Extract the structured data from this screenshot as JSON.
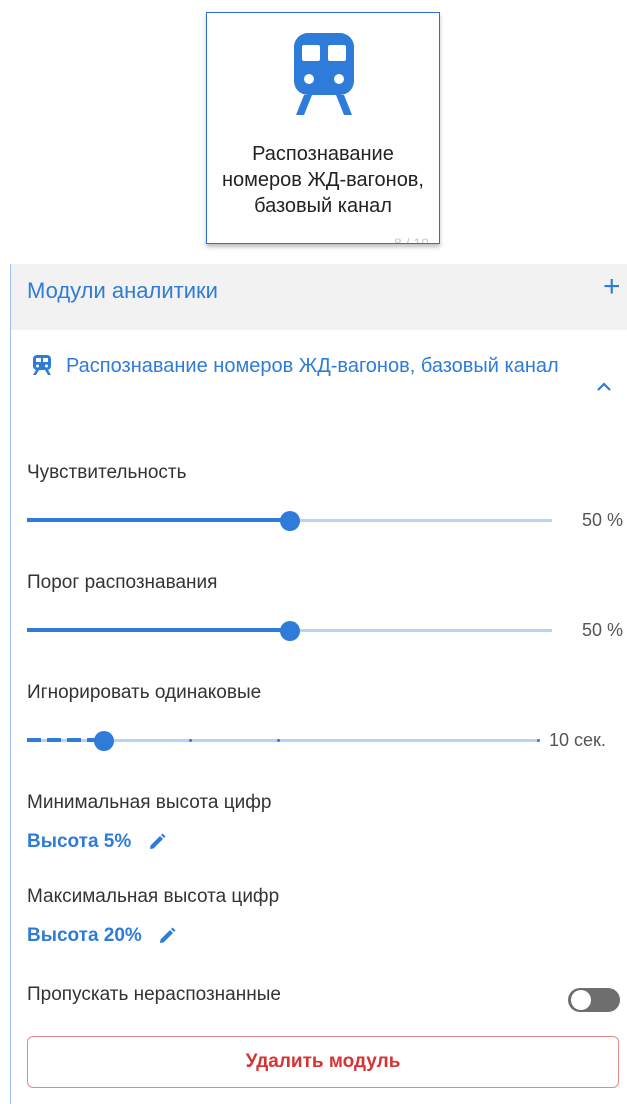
{
  "tile": {
    "icon": "train-icon",
    "label": "Распознавание номеров ЖД-вагонов, базовый канал",
    "counter": "8 / 10"
  },
  "panel": {
    "title": "Модули аналитики",
    "add_icon": "plus-icon",
    "add_label": "+"
  },
  "module": {
    "icon": "train-icon",
    "title": "Распознавание номеров ЖД-вагонов, базовый канал",
    "expanded_icon": "chevron-up-icon"
  },
  "sensitivity": {
    "label": "Чувствительность",
    "value": 50,
    "display": "50 %"
  },
  "threshold": {
    "label": "Порог распознавания",
    "value": 50,
    "display": "50 %"
  },
  "ignore_same": {
    "label": "Игнорировать одинаковые",
    "value_fraction": 0.15,
    "display": "10 сек."
  },
  "min_height": {
    "label": "Минимальная высота цифр",
    "value": "Высота 5%",
    "edit_icon": "pencil-icon"
  },
  "max_height": {
    "label": "Максимальная высота цифр",
    "value": "Высота 20%",
    "edit_icon": "pencil-icon"
  },
  "skip_unrecognized": {
    "label": "Пропускать нераспознанные",
    "enabled": false
  },
  "delete_button": {
    "label": "Удалить модуль"
  },
  "colors": {
    "accent": "#2f7bd9",
    "danger": "#d63333",
    "toggle_off": "#6e6e6e"
  }
}
